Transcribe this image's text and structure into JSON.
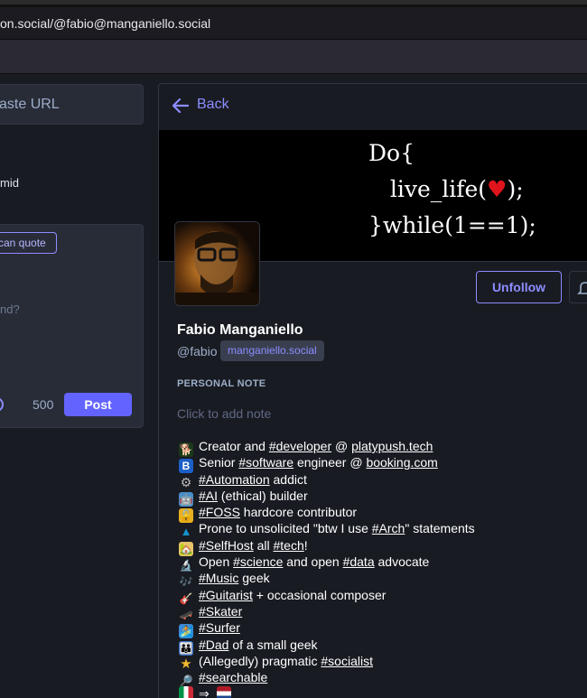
{
  "browser": {
    "url": "on.social/@fabio@manganiello.social"
  },
  "compose": {
    "search_placeholder": "aste URL",
    "account_fragment": "mid",
    "quote_badge": "can quote",
    "placeholder": "nd?",
    "char_count": "500",
    "post_label": "Post"
  },
  "profile": {
    "back_label": "Back",
    "header_code": [
      "Do{",
      "   live_life(",
      ");",
      "}while(1==1);"
    ],
    "unfollow_label": "Unfollow",
    "display_name": "Fabio Manganiello",
    "handle": "@fabio",
    "domain": "manganiello.social",
    "personal_note_title": "PERSONAL NOTE",
    "personal_note_placeholder": "Click to add note"
  },
  "bio": [
    {
      "icon": "dog-icon",
      "emoji": "🐕",
      "pre": "Creator and ",
      "tag": "#developer",
      "mid": " @ ",
      "link": "platypush.tech",
      "post": ""
    },
    {
      "icon": "letter-b-icon",
      "emoji": "B",
      "pre": "Senior ",
      "tag": "#software",
      "mid": " engineer @ ",
      "link": "booking.com",
      "post": ""
    },
    {
      "icon": "gear-icon",
      "emoji": "⚙",
      "pre": "",
      "tag": "#Automation",
      "mid": " addict",
      "link": "",
      "post": ""
    },
    {
      "icon": "robot-icon",
      "emoji": "🤖",
      "pre": "",
      "tag": "#AI",
      "mid": " (ethical) builder",
      "link": "",
      "post": ""
    },
    {
      "icon": "lock-icon",
      "emoji": "🔓",
      "pre": "",
      "tag": "#FOSS",
      "mid": " hardcore contributor",
      "link": "",
      "post": ""
    },
    {
      "icon": "arch-linux-icon",
      "emoji": "▲",
      "pre": "Prone to unsolicited \"btw I use ",
      "tag": "#Arch",
      "mid": "\" statements",
      "link": "",
      "post": ""
    },
    {
      "icon": "house-icon",
      "emoji": "🏡",
      "pre": "",
      "tag": "#SelfHost",
      "mid": " all ",
      "link": "",
      "post": "",
      "tag2": "#tech",
      "end": "!"
    },
    {
      "icon": "microscope-icon",
      "emoji": "🔬",
      "pre": "Open ",
      "tag": "#science",
      "mid": " and open ",
      "link": "",
      "post": "",
      "tag2": "#data",
      "end": " advocate"
    },
    {
      "icon": "music-notes-icon",
      "emoji": "🎶",
      "pre": "",
      "tag": "#Music",
      "mid": " geek",
      "link": "",
      "post": ""
    },
    {
      "icon": "guitar-icon",
      "emoji": "🎸",
      "pre": "",
      "tag": "#Guitarist",
      "mid": " + occasional composer",
      "link": "",
      "post": ""
    },
    {
      "icon": "skateboard-icon",
      "emoji": "🛹",
      "pre": "",
      "tag": "#Skater",
      "mid": "",
      "link": "",
      "post": ""
    },
    {
      "icon": "surfer-icon",
      "emoji": "🏄",
      "pre": "",
      "tag": "#Surfer",
      "mid": "",
      "link": "",
      "post": ""
    },
    {
      "icon": "family-icon",
      "emoji": "👪",
      "pre": "",
      "tag": "#Dad",
      "mid": " of a small geek",
      "link": "",
      "post": ""
    },
    {
      "icon": "star-icon",
      "emoji": "★",
      "pre": "(Allegedly) pragmatic ",
      "tag": "#socialist",
      "mid": "",
      "link": "",
      "post": ""
    },
    {
      "icon": "magnifier-icon",
      "emoji": "🔎",
      "pre": "",
      "tag": "#searchable",
      "mid": "",
      "link": "",
      "post": ""
    },
    {
      "icon": "flags-icon",
      "emoji": "",
      "pre": "",
      "tag": "",
      "mid": "⇒",
      "link": "",
      "post": ""
    }
  ],
  "colors": {
    "accent": "#8c8dff",
    "button": "#6364ff",
    "background": "#191b22",
    "panel": "#282c37"
  }
}
